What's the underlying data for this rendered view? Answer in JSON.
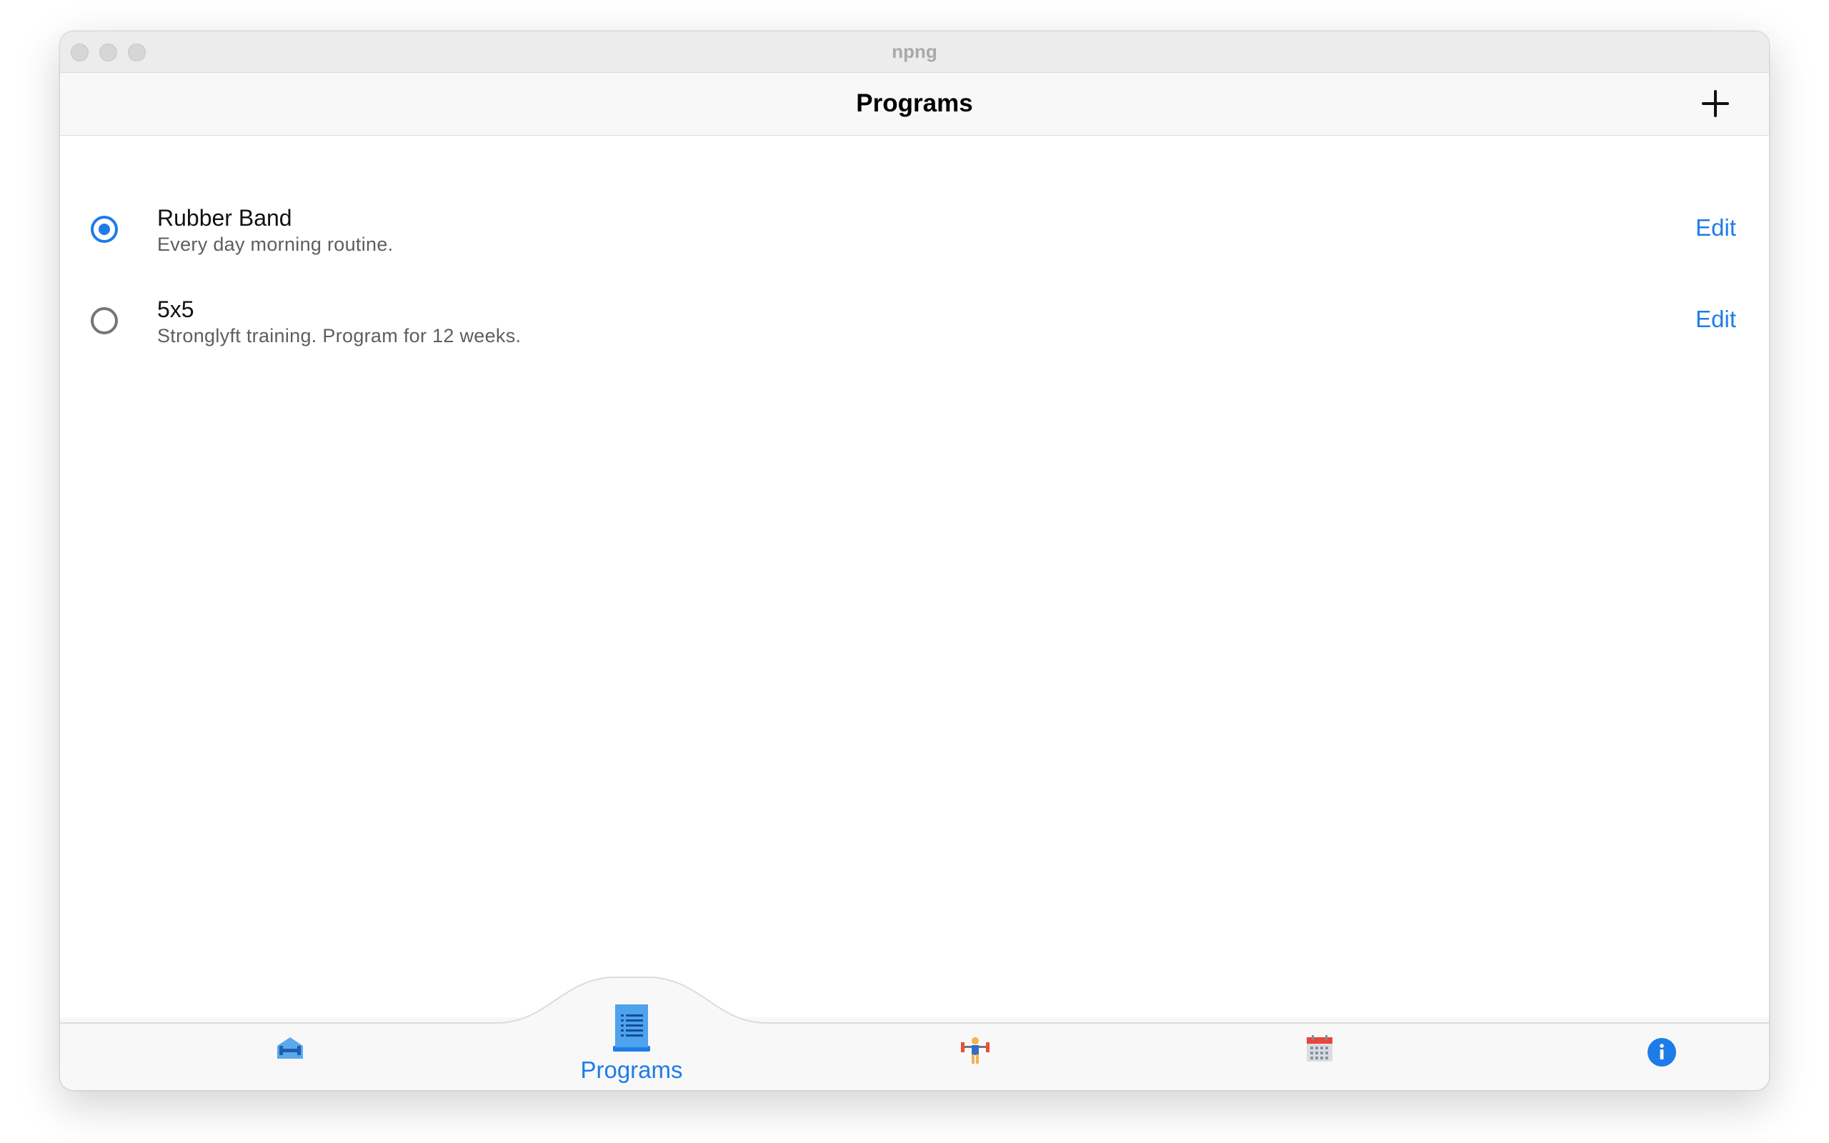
{
  "window": {
    "title": "npng"
  },
  "navbar": {
    "title": "Programs",
    "add_icon": "plus-icon"
  },
  "programs": [
    {
      "name": "Rubber Band",
      "description": "Every day morning routine.",
      "selected": true,
      "edit_label": "Edit"
    },
    {
      "name": "5x5",
      "description": "Stronglyft training. Program for 12 weeks.",
      "selected": false,
      "edit_label": "Edit"
    }
  ],
  "tabbar": {
    "tabs": [
      {
        "icon": "gym-dumbbell-icon",
        "label": "",
        "active": false
      },
      {
        "icon": "program-list-icon",
        "label": "Programs",
        "active": true
      },
      {
        "icon": "weightlifter-icon",
        "label": "",
        "active": false
      },
      {
        "icon": "calendar-icon",
        "label": "",
        "active": false
      },
      {
        "icon": "info-icon",
        "label": "",
        "active": false
      }
    ]
  },
  "colors": {
    "accent": "#1e7ce8",
    "title_text": "#000000",
    "subtitle_text": "#5e5e5e",
    "bar_background": "#f8f8f8"
  }
}
